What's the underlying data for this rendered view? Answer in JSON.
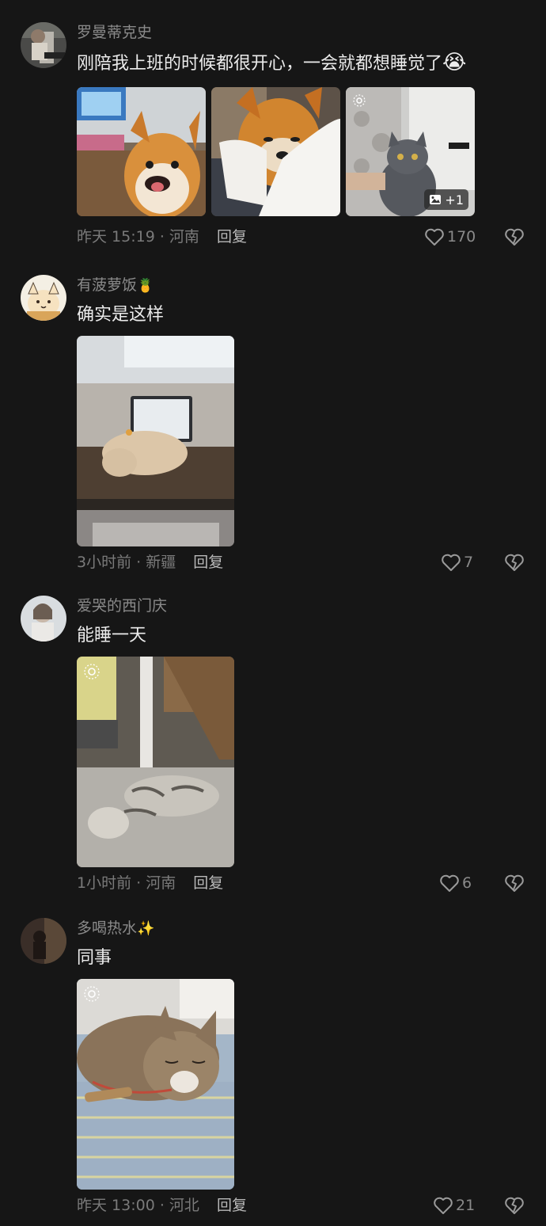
{
  "comments": [
    {
      "username": "罗曼蒂克史",
      "text": "刚陪我上班的时候都很开心，一会就都想睡觉了",
      "time": "昨天 15:19",
      "location": "河南",
      "reply_label": "回复",
      "likes": "170",
      "image_badge": "+1"
    },
    {
      "username": "有菠萝饭",
      "text": "确实是这样",
      "time": "3小时前",
      "location": "新疆",
      "reply_label": "回复",
      "likes": "7"
    },
    {
      "username": "爱哭的西门庆",
      "text": "能睡一天",
      "time": "1小时前",
      "location": "河南",
      "reply_label": "回复",
      "likes": "6"
    },
    {
      "username": "多喝热水",
      "text": "同事",
      "time": "昨天 13:00",
      "location": "河北",
      "reply_label": "回复",
      "likes": "21"
    }
  ],
  "emojis": {
    "crying_face": "😭",
    "pineapple": "🍍",
    "sparkles": "✨"
  },
  "colors": {
    "background": "#161616",
    "username": "#8a8a8a",
    "text": "#ececec",
    "meta": "#7a7a7a"
  },
  "icons": [
    "heart-outline-icon",
    "broken-heart-icon",
    "image-stack-icon",
    "live-photo-icon"
  ]
}
